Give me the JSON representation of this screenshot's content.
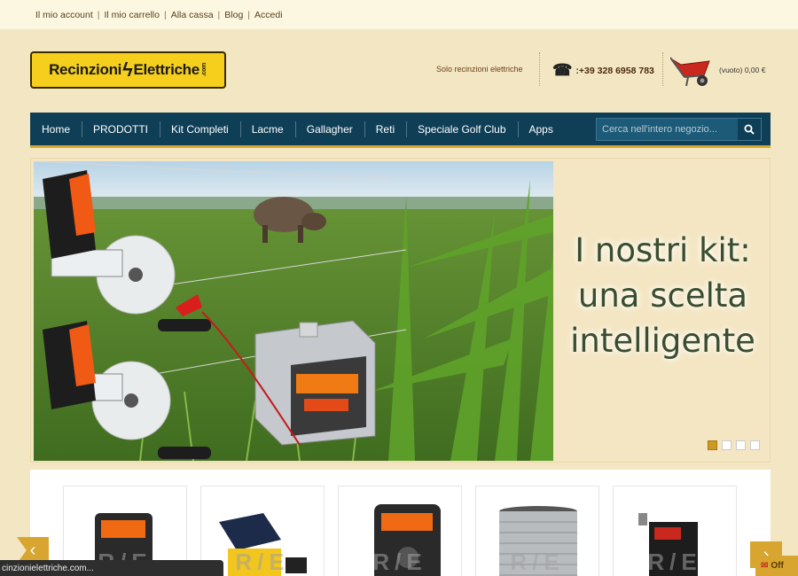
{
  "topbar": {
    "links": [
      "Il mio account",
      "Il mio carrello",
      "Alla cassa",
      "Blog",
      "Accedi"
    ]
  },
  "header": {
    "logo_text_left": "Recinzioni",
    "logo_text_right": "Elettriche",
    "logo_com": ".com",
    "tagline": "Solo recinzioni elettriche",
    "phone": ":+39 328 6958 783",
    "cart_text": "(vuoto) 0,00 €"
  },
  "nav": {
    "items": [
      "Home",
      "PRODOTTI",
      "Kit Completi",
      "Lacme",
      "Gallagher",
      "Reti",
      "Speciale Golf Club",
      "Apps"
    ],
    "search_placeholder": "Cerca nell'intero negozio..."
  },
  "slider": {
    "caption_line1": "I nostri kit:",
    "caption_line2": "una scelta",
    "caption_line3": "intelligente",
    "total_slides": 4,
    "active_slide": 1
  },
  "products": {
    "watermark": "R/E"
  },
  "status_bar": "cinzionielettriche.com...",
  "offline_label": "Off",
  "colors": {
    "nav_bg": "#0f3f57",
    "accent": "#d8a530",
    "page_bg": "#f3e7c3"
  }
}
